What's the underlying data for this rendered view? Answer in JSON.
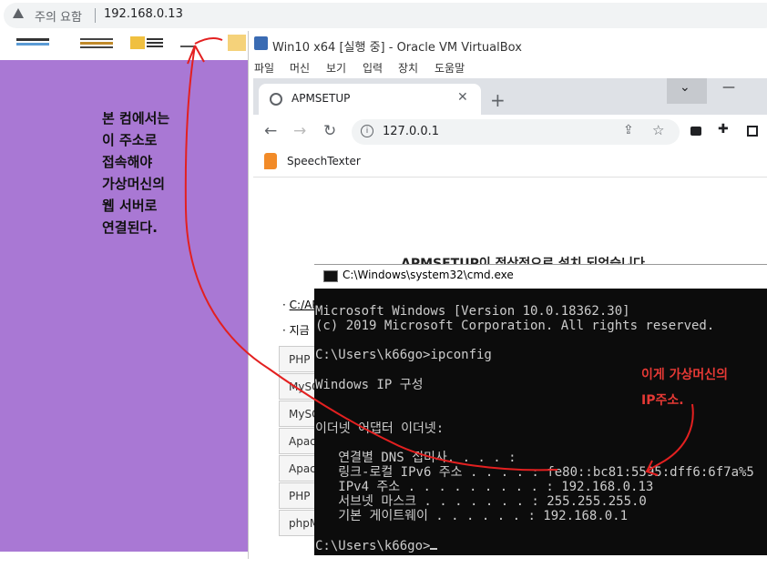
{
  "host_browser": {
    "warning_label": "주의 요함",
    "url": "192.168.0.13"
  },
  "left_annotation": "본 컴에서는\n이 주소로\n접속해야\n가상머신의\n웹 서버로\n연결된다.",
  "virtualbox": {
    "title": "Win10 x64 [실행 중] - Oracle VM VirtualBox",
    "menu": [
      "파일",
      "머신",
      "보기",
      "입력",
      "장치",
      "도움말"
    ]
  },
  "guest_browser": {
    "tab_title": "APMSETUP",
    "url": "127.0.0.1",
    "bookmark": "SpeechTexter",
    "page_heading": "APMSETUP이 정상적으로 설치 되었습니다",
    "link_text": "C:/AP",
    "list_item": "· 지금",
    "table_rows": [
      "PHP 버",
      "MySQL",
      "MySQ",
      "Apach",
      "Apach",
      "PHP I",
      "phpM"
    ]
  },
  "cmd": {
    "title": "C:\\Windows\\system32\\cmd.exe",
    "lines": [
      "Microsoft Windows [Version 10.0.18362.30]",
      "(c) 2019 Microsoft Corporation. All rights reserved.",
      "",
      "C:\\Users\\k66go>ipconfig",
      "",
      "Windows IP 구성",
      "",
      "",
      "이더넷 어댑터 이더넷:",
      "",
      "   연결별 DNS 접미사. . . . :",
      "   링크-로컬 IPv6 주소 . . . . : fe80::bc81:5595:dff6:6f7a%5",
      "   IPv4 주소 . . . . . . . . . : 192.168.0.13",
      "   서브넷 마스크 . . . . . . . : 255.255.255.0",
      "   기본 게이트웨이 . . . . . . : 192.168.0.1",
      "",
      "C:\\Users\\k66go>"
    ]
  },
  "right_annotation": "이게 가상머신의\nIP주소.",
  "colors": {
    "host_background": "#a978d4",
    "annotation_red": "#e53935",
    "cmd_background": "#0c0c0c"
  }
}
